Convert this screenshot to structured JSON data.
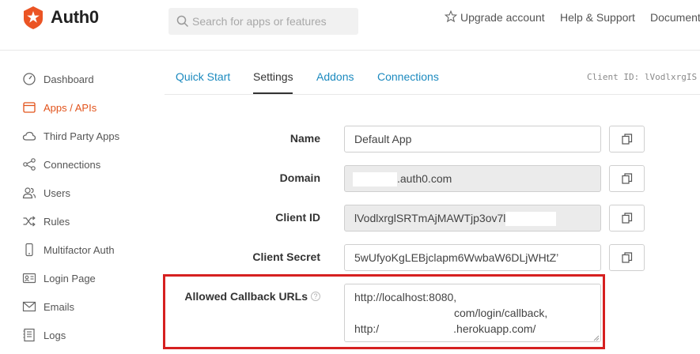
{
  "app": {
    "name": "Auth0",
    "brand_color": "#eb5424"
  },
  "header": {
    "search_placeholder": "Search for apps or features",
    "upgrade_label": "Upgrade account",
    "help_label": "Help & Support",
    "docs_label": "Document"
  },
  "sidebar": {
    "items": [
      {
        "label": "Dashboard",
        "icon": "gauge-icon"
      },
      {
        "label": "Apps / APIs",
        "icon": "window-icon",
        "active": true
      },
      {
        "label": "Third Party Apps",
        "icon": "cloud-icon"
      },
      {
        "label": "Connections",
        "icon": "share-icon"
      },
      {
        "label": "Users",
        "icon": "users-icon"
      },
      {
        "label": "Rules",
        "icon": "shuffle-icon"
      },
      {
        "label": "Multifactor Auth",
        "icon": "phone-icon"
      },
      {
        "label": "Login Page",
        "icon": "id-card-icon"
      },
      {
        "label": "Emails",
        "icon": "envelope-icon"
      },
      {
        "label": "Logs",
        "icon": "book-icon"
      }
    ]
  },
  "tabs": [
    {
      "label": "Quick Start"
    },
    {
      "label": "Settings",
      "active": true
    },
    {
      "label": "Addons"
    },
    {
      "label": "Connections"
    }
  ],
  "client_id_header": "Client ID: lVodlxrgIS",
  "form": {
    "name": {
      "label": "Name",
      "value": "Default App"
    },
    "domain": {
      "label": "Domain",
      "value_suffix": ".auth0.com"
    },
    "client_id": {
      "label": "Client ID",
      "value": "lVodlxrglSRTmAjMAWTjp3ov7l"
    },
    "client_secret": {
      "label": "Client Secret",
      "value": "5wUfyoKgLEBjclapm6WwbaW6DLjWHtZ’"
    },
    "callback_urls": {
      "label": "Allowed Callback URLs",
      "line1": "http://localhost:8080,",
      "line2": "com/login/callback,",
      "line3_prefix": "http:/",
      "line3_suffix": ".herokuapp.com/"
    }
  },
  "colors": {
    "link": "#1c8abf",
    "active_nav": "#e2531b",
    "highlight": "#d62020"
  }
}
